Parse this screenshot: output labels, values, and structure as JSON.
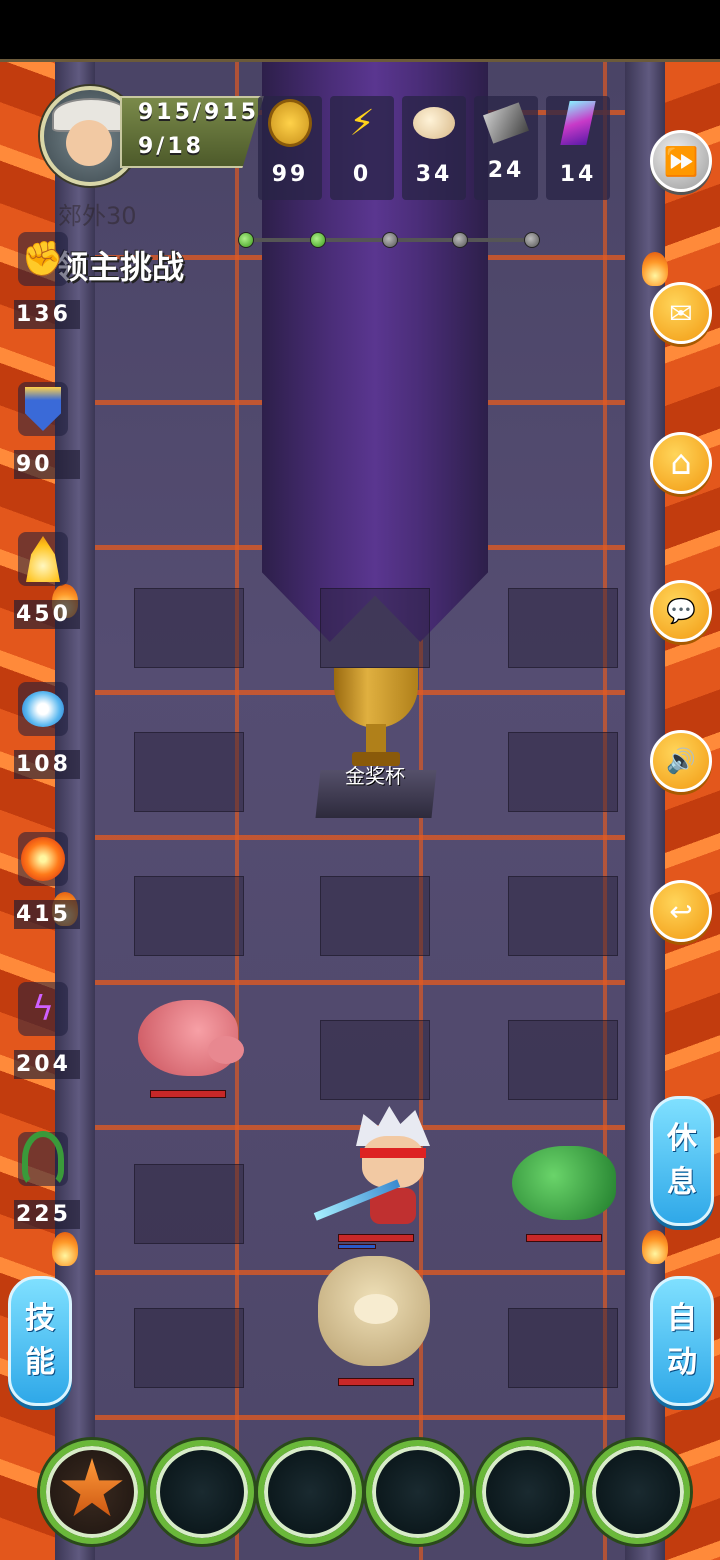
{
  "hud": {
    "hp": "915/915",
    "level": "9/18",
    "area_name": "郊外30",
    "stage_title": "领主挑战",
    "stage_progress": {
      "total": 5,
      "completed": 2
    }
  },
  "resources": [
    {
      "name": "coin-icon",
      "value": "99"
    },
    {
      "name": "lightning-icon",
      "value": "0"
    },
    {
      "name": "bun-icon",
      "value": "34"
    },
    {
      "name": "ore-icon",
      "value": "24"
    },
    {
      "name": "crystal-icon",
      "value": "14"
    }
  ],
  "skills": [
    {
      "name": "fist-icon",
      "value": "136"
    },
    {
      "name": "shield-icon",
      "value": "90"
    },
    {
      "name": "flame-spirit-icon",
      "value": "450"
    },
    {
      "name": "whirlwind-icon",
      "value": "108"
    },
    {
      "name": "fireball-icon",
      "value": "415"
    },
    {
      "name": "purple-lightning-icon",
      "value": "204"
    },
    {
      "name": "green-wing-icon",
      "value": "225"
    }
  ],
  "field": {
    "trophy_label": "金奖杯"
  },
  "buttons": {
    "rest": [
      "休",
      "息"
    ],
    "skill": [
      "技",
      "能"
    ],
    "auto": [
      "自",
      "动"
    ]
  },
  "icons": {
    "fast_forward": "⏩",
    "mail": "✉",
    "home": "⌂",
    "chat": "💬",
    "sound": "🔊",
    "back": "↩"
  },
  "colors": {
    "hp_bar": "#c82828",
    "mp_bar": "#2a5ac8",
    "slot_ring": "#6ab83a",
    "accent_button": "#2fa8e8"
  }
}
